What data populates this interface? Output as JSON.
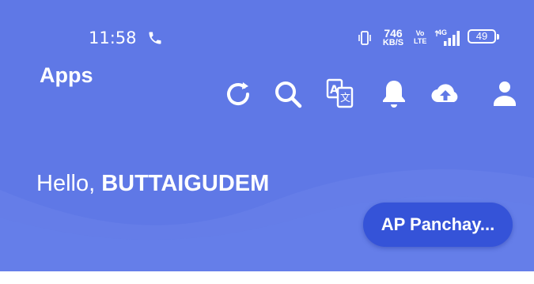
{
  "status_bar": {
    "time": "11:58",
    "net_speed_value": "746",
    "net_speed_unit": "KB/S",
    "volte_top": "Vo",
    "volte_bottom": "LTE",
    "network": "4G",
    "battery": "49"
  },
  "app_bar": {
    "title": "Apps",
    "icons": [
      "refresh-icon",
      "search-icon",
      "translate-icon",
      "notification-bell-icon",
      "cloud-upload-icon",
      "profile-icon"
    ]
  },
  "main": {
    "greeting_prefix": "Hello, ",
    "greeting_name": "BUTTAIGUDEM",
    "panchayat_button_label": "AP Panchay..."
  },
  "colors": {
    "background": "#5f78e6",
    "button": "#3553d8",
    "text": "#ffffff"
  }
}
